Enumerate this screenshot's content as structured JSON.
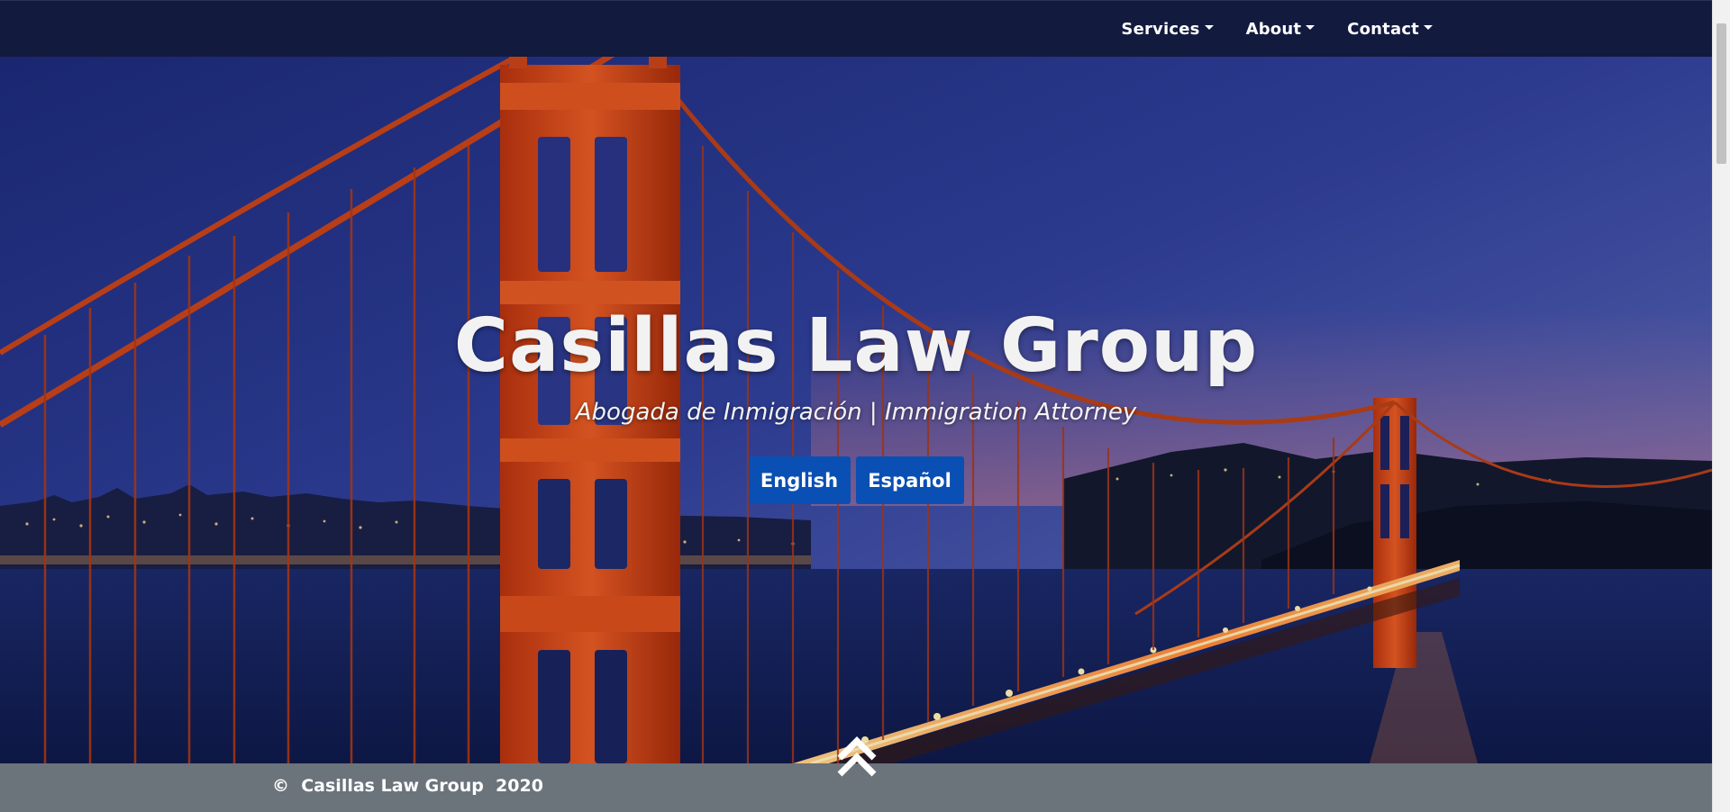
{
  "nav": {
    "items": [
      {
        "label": "Services"
      },
      {
        "label": "About"
      },
      {
        "label": "Contact"
      }
    ]
  },
  "hero": {
    "title": "Casillas Law Group",
    "subtitle": "Abogada de Inmigración | Immigration Attorney",
    "buttons": {
      "english": "English",
      "spanish": "Español"
    },
    "background": "golden-gate-bridge-night-photo"
  },
  "footer": {
    "copyright": "©  Casillas Law Group  2020"
  },
  "icons": {
    "scroll_top": "double-chevron-up-icon",
    "nav_caret": "caret-down-icon"
  },
  "colors": {
    "navbar_bg": "#121a3e",
    "button_bg": "#0a4fb3",
    "footer_bg": "#6b737b",
    "bridge_red": "#d8461c"
  }
}
